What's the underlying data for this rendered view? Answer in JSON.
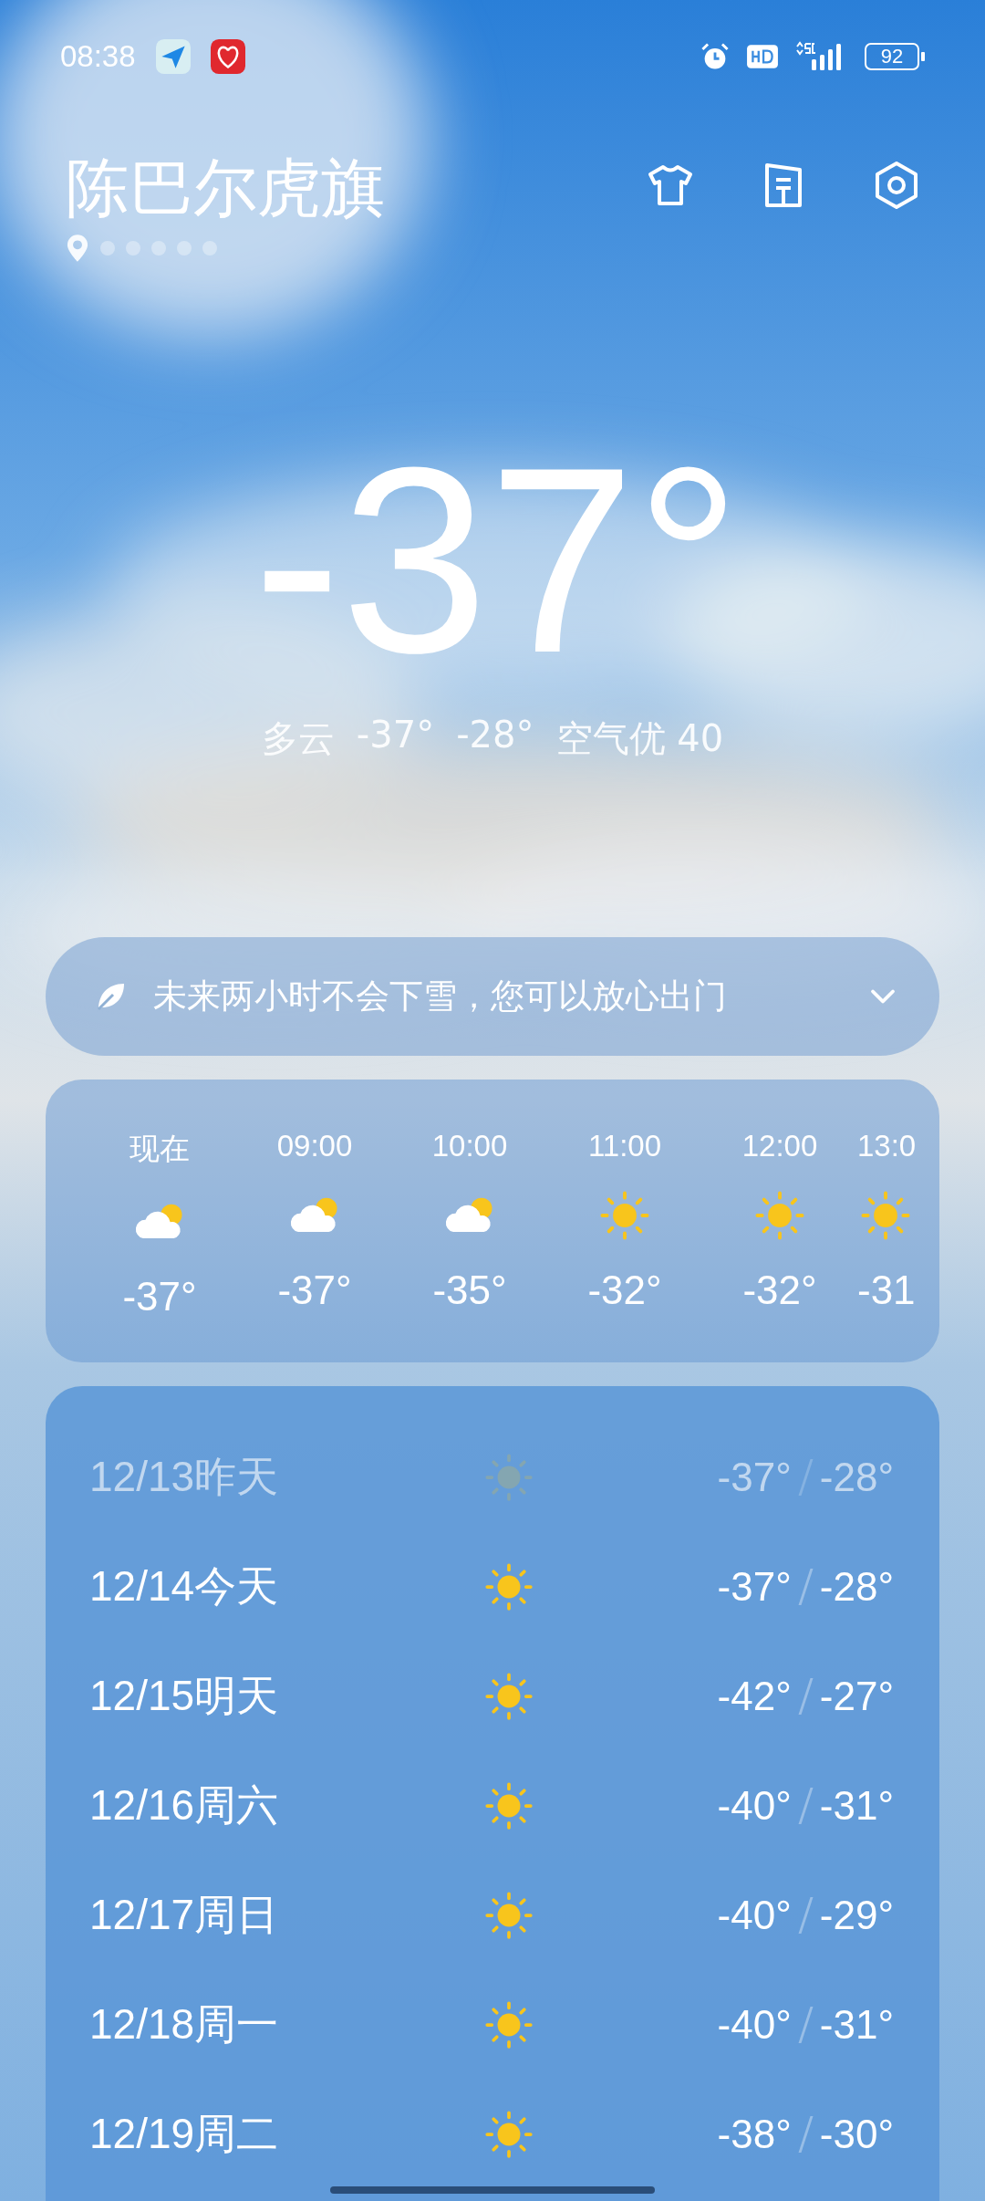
{
  "status_bar": {
    "time": "08:38",
    "battery": "92"
  },
  "header": {
    "city": "陈巴尔虎旗"
  },
  "page_indicator": [
    {
      "kind": "location",
      "selected": true
    },
    {
      "kind": "dot",
      "selected": false
    },
    {
      "kind": "dot",
      "selected": false
    },
    {
      "kind": "dot",
      "selected": false
    },
    {
      "kind": "dot",
      "selected": false
    },
    {
      "kind": "dot",
      "selected": false
    }
  ],
  "current": {
    "temperature": "-37°",
    "condition": "多云",
    "low": "-37°",
    "high": "-28°",
    "air_quality": "空气优 40"
  },
  "alert": {
    "text": "未来两小时不会下雪，您可以放心出门",
    "expanded": false
  },
  "hourly": [
    {
      "time": "现在",
      "kind": "cloudy",
      "temp": "-37°"
    },
    {
      "time": "09:00",
      "kind": "cloudy",
      "temp": "-37°"
    },
    {
      "time": "10:00",
      "kind": "cloudy",
      "temp": "-35°"
    },
    {
      "time": "11:00",
      "kind": "sunny",
      "temp": "-32°"
    },
    {
      "time": "12:00",
      "kind": "sunny",
      "temp": "-32°"
    },
    {
      "time": "13:0",
      "kind": "sunny",
      "temp": "-31"
    }
  ],
  "daily": [
    {
      "date": "12/13昨天",
      "kind": "sunny",
      "low": "-37°",
      "high": "-28°",
      "past": true
    },
    {
      "date": "12/14今天",
      "kind": "sunny",
      "low": "-37°",
      "high": "-28°",
      "past": false
    },
    {
      "date": "12/15明天",
      "kind": "sunny",
      "low": "-42°",
      "high": "-27°",
      "past": false
    },
    {
      "date": "12/16周六",
      "kind": "sunny",
      "low": "-40°",
      "high": "-31°",
      "past": false
    },
    {
      "date": "12/17周日",
      "kind": "sunny",
      "low": "-40°",
      "high": "-29°",
      "past": false
    },
    {
      "date": "12/18周一",
      "kind": "sunny",
      "low": "-40°",
      "high": "-31°",
      "past": false
    },
    {
      "date": "12/19周二",
      "kind": "sunny",
      "low": "-38°",
      "high": "-30°",
      "past": false
    }
  ]
}
